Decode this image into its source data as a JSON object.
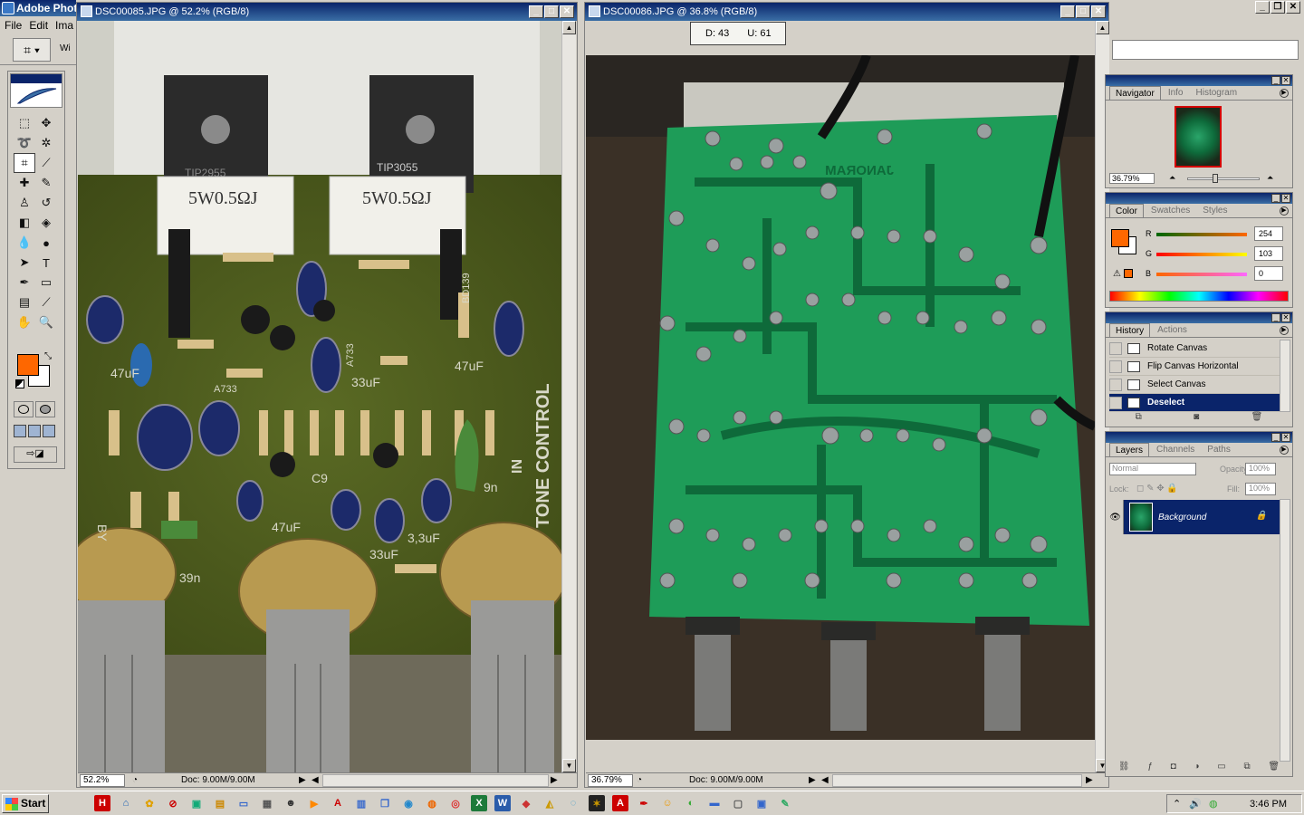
{
  "app": {
    "title": "Adobe Photoshop",
    "menu": [
      "File",
      "Edit",
      "Ima"
    ],
    "options_label": "Wi"
  },
  "doc1": {
    "title": "DSC00085.JPG @ 52.2% (RGB/8)",
    "zoom": "52.2%",
    "doc_size": "Doc: 9.00M/9.00M",
    "photo_labels": {
      "resistor1": "5W0.5ΩJ",
      "resistor2": "5W0.5ΩJ",
      "transistor1": "TIP2955",
      "transistor2": "TIP3055",
      "board_text": "TONE CONTROL",
      "in_text": "IN",
      "cap1": "47uF",
      "cap2": "33uF",
      "cap3": "47uF",
      "cap4": "33uF",
      "cap5": "3,3uF",
      "cap6": "47uF",
      "c9": "C9",
      "n39": "39n",
      "n9": "9n",
      "by": "BY",
      "bd139": "BD139",
      "a733": "A733",
      "a733b": "A733"
    }
  },
  "doc2": {
    "title": "DSC00086.JPG @ 36.8% (RGB/8)",
    "zoom": "36.79%",
    "doc_size": "Doc: 9.00M/9.00M",
    "photo_text": "JANORAM"
  },
  "info_popup": {
    "d": "D: 43",
    "u": "U: 61"
  },
  "navigator": {
    "tabs": [
      "Navigator",
      "Info",
      "Histogram"
    ],
    "zoom": "36.79%"
  },
  "color": {
    "tabs": [
      "Color",
      "Swatches",
      "Styles"
    ],
    "r_label": "R",
    "g_label": "G",
    "b_label": "B",
    "r": "254",
    "g": "103",
    "b": "0",
    "fg": "#fe6700"
  },
  "history": {
    "tabs": [
      "History",
      "Actions"
    ],
    "items": [
      "Rotate Canvas",
      "Flip Canvas Horizontal",
      "Select Canvas",
      "Deselect"
    ]
  },
  "layers": {
    "tabs": [
      "Layers",
      "Channels",
      "Paths"
    ],
    "blend": "Normal",
    "opacity_label": "Opacity:",
    "opacity": "100%",
    "lock_label": "Lock:",
    "fill_label": "Fill:",
    "fill": "100%",
    "layer_name": "Background"
  },
  "taskbar": {
    "start": "Start",
    "time": "3:46 PM"
  }
}
